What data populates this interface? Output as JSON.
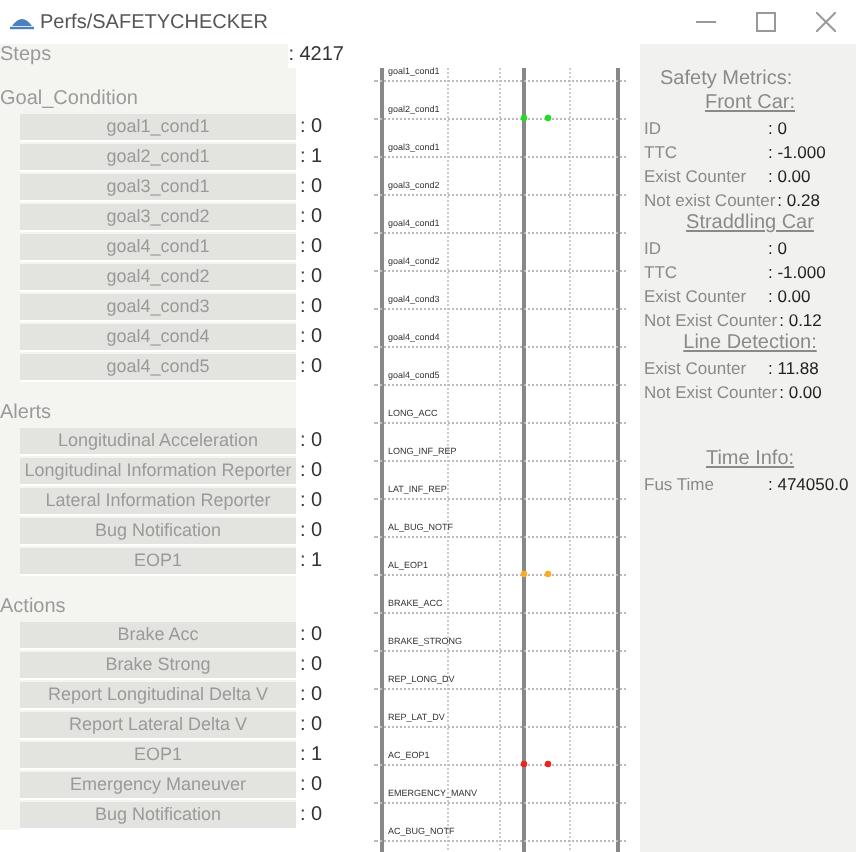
{
  "window": {
    "title": "Perfs/SAFETYCHECKER"
  },
  "steps": {
    "label": "Steps",
    "value": ": 4217"
  },
  "groups": [
    {
      "title": "Goal_Condition",
      "items": [
        {
          "label": "goal1_cond1",
          "value": ": 0"
        },
        {
          "label": "goal2_cond1",
          "value": ": 1"
        },
        {
          "label": "goal3_cond1",
          "value": ": 0"
        },
        {
          "label": "goal3_cond2",
          "value": ": 0"
        },
        {
          "label": "goal4_cond1",
          "value": ": 0"
        },
        {
          "label": "goal4_cond2",
          "value": ": 0"
        },
        {
          "label": "goal4_cond3",
          "value": ": 0"
        },
        {
          "label": "goal4_cond4",
          "value": ": 0"
        },
        {
          "label": "goal4_cond5",
          "value": ": 0"
        }
      ]
    },
    {
      "title": "Alerts",
      "items": [
        {
          "label": "Longitudinal Acceleration",
          "value": ": 0"
        },
        {
          "label": "Longitudinal Information Reporter",
          "value": ": 0"
        },
        {
          "label": "Lateral Information Reporter",
          "value": ": 0"
        },
        {
          "label": "Bug Notification",
          "value": ": 0"
        },
        {
          "label": "EOP1",
          "value": ": 1"
        }
      ]
    },
    {
      "title": "Actions",
      "items": [
        {
          "label": "Brake Acc",
          "value": ": 0"
        },
        {
          "label": "Brake Strong",
          "value": ": 0"
        },
        {
          "label": "Report Longitudinal Delta V",
          "value": ": 0"
        },
        {
          "label": "Report Lateral Delta V",
          "value": ": 0"
        },
        {
          "label": "EOP1",
          "value": ": 1"
        },
        {
          "label": "Emergency Maneuver",
          "value": ": 0"
        },
        {
          "label": "Bug Notification",
          "value": ": 0"
        }
      ]
    }
  ],
  "timeline": [
    {
      "label": "goal1_cond1",
      "event": false
    },
    {
      "label": "goal2_cond1",
      "event": true,
      "color": "#22dd22"
    },
    {
      "label": "goal3_cond1",
      "event": false
    },
    {
      "label": "goal3_cond2",
      "event": false
    },
    {
      "label": "goal4_cond1",
      "event": false
    },
    {
      "label": "goal4_cond2",
      "event": false
    },
    {
      "label": "goal4_cond3",
      "event": false
    },
    {
      "label": "goal4_cond4",
      "event": false
    },
    {
      "label": "goal4_cond5",
      "event": false
    },
    {
      "label": "LONG_ACC",
      "event": false
    },
    {
      "label": "LONG_INF_REP",
      "event": false
    },
    {
      "label": "LAT_INF_REP",
      "event": false
    },
    {
      "label": "AL_BUG_NOTF",
      "event": false
    },
    {
      "label": "AL_EOP1",
      "event": true,
      "color": "#ffaa22"
    },
    {
      "label": "BRAKE_ACC",
      "event": false
    },
    {
      "label": "BRAKE_STRONG",
      "event": false
    },
    {
      "label": "REP_LONG_DV",
      "event": false
    },
    {
      "label": "REP_LAT_DV",
      "event": false
    },
    {
      "label": "AC_EOP1",
      "event": true,
      "color": "#ee2222"
    },
    {
      "label": "EMERGENCY_MANV",
      "event": false
    },
    {
      "label": "AC_BUG_NOTF",
      "event": false
    }
  ],
  "metrics": {
    "title": "Safety Metrics:",
    "sections": [
      {
        "heading": "Front Car:",
        "rows": [
          {
            "key": "ID",
            "value": ": 0"
          },
          {
            "key": "TTC",
            "value": ": -1.000"
          },
          {
            "key": "Exist Counter",
            "value": ": 0.00"
          },
          {
            "key": "Not exist Counter",
            "value": ": 0.28"
          }
        ]
      },
      {
        "heading": "Straddling Car",
        "rows": [
          {
            "key": "ID",
            "value": ": 0"
          },
          {
            "key": "TTC",
            "value": ": -1.000"
          },
          {
            "key": "Exist Counter",
            "value": ": 0.00"
          },
          {
            "key": "Not Exist Counter",
            "value": ": 0.12"
          }
        ]
      },
      {
        "heading": "Line Detection:",
        "rows": [
          {
            "key": "Exist Counter",
            "value": ": 11.88"
          },
          {
            "key": "Not Exist Counter",
            "value": ": 0.00"
          }
        ]
      }
    ],
    "time": {
      "heading": "Time Info:",
      "rows": [
        {
          "key": "Fus Time",
          "value": ": 474050.0"
        }
      ]
    }
  }
}
